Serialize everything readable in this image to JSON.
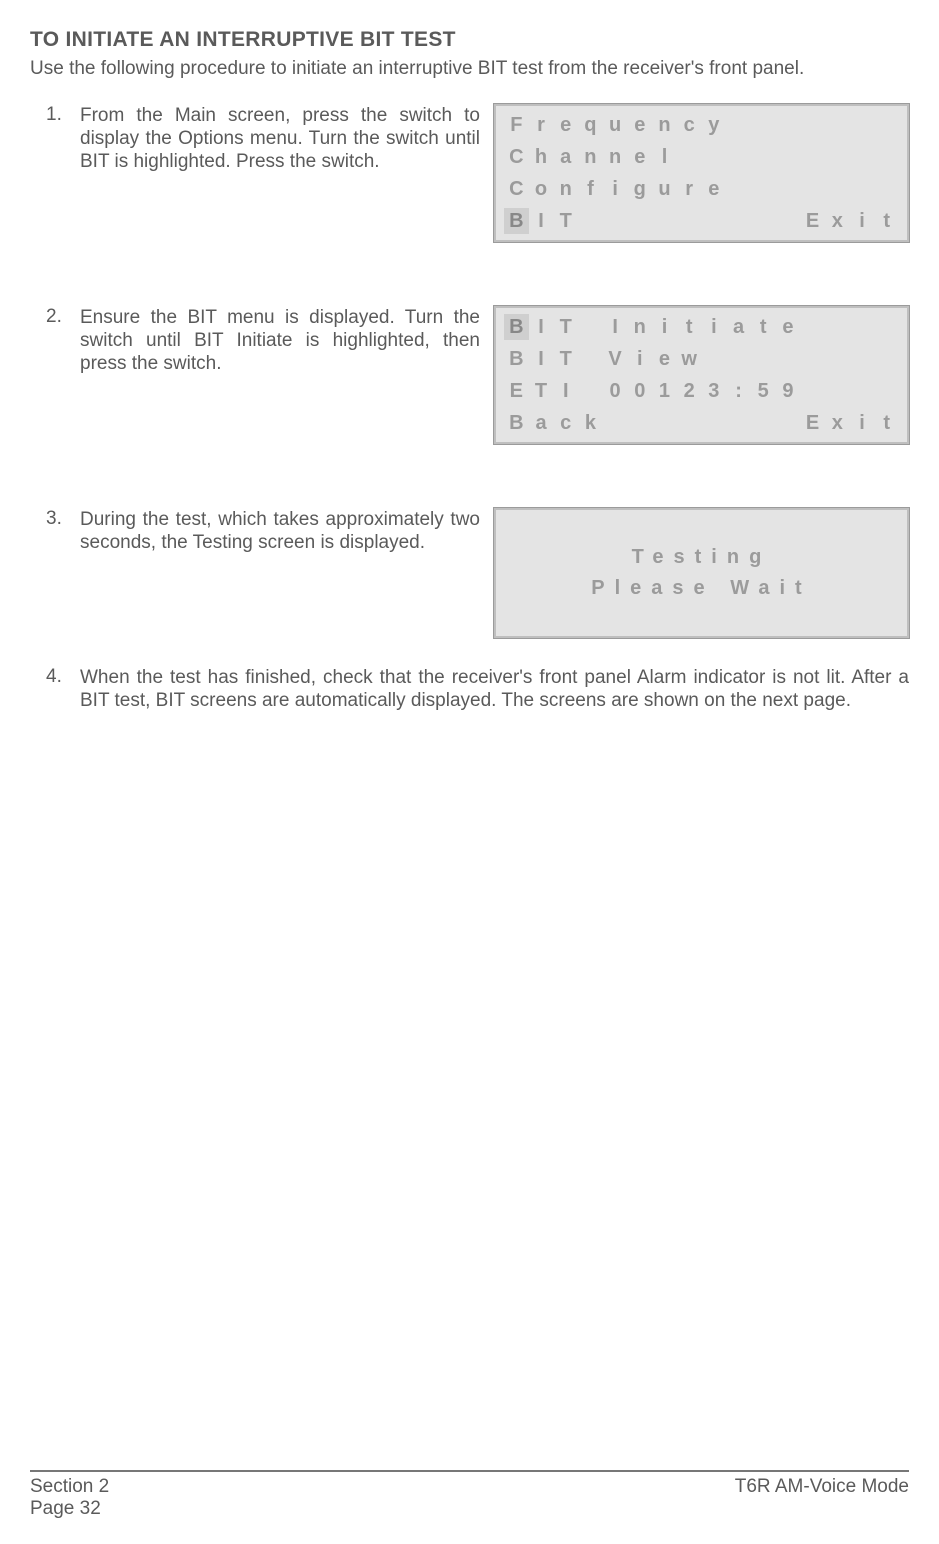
{
  "title": "TO INITIATE AN INTERRUPTIVE BIT TEST",
  "intro": "Use the following procedure to initiate an interruptive BIT test from the receiver's front panel.",
  "steps": {
    "s1": {
      "num": "1.",
      "text": "From the Main screen, press the switch to display the Options menu. Turn the switch until BIT is highlighted. Press the switch."
    },
    "s2": {
      "num": "2.",
      "text": "Ensure the BIT menu is displayed. Turn the switch until BIT Initiate is highlighted, then press the switch."
    },
    "s3": {
      "num": "3.",
      "text": "During the test, which takes approximately two seconds, the Testing screen is displayed."
    },
    "s4": {
      "num": "4.",
      "text": "When the test has finished, check that the receiver's front panel Alarm indicator is not lit. After a BIT test, BIT screens are automatically displayed. The screens are shown on the next page."
    }
  },
  "lcd1": {
    "rows": [
      [
        "F",
        "r",
        "e",
        "q",
        "u",
        "e",
        "n",
        "c",
        "y",
        "",
        "",
        "",
        "",
        "",
        "",
        ""
      ],
      [
        "C",
        "h",
        "a",
        "n",
        "n",
        "e",
        "l",
        "",
        "",
        "",
        "",
        "",
        "",
        "",
        "",
        ""
      ],
      [
        "C",
        "o",
        "n",
        "f",
        "i",
        "g",
        "u",
        "r",
        "e",
        "",
        "",
        "",
        "",
        "",
        "",
        ""
      ],
      [
        "B",
        "I",
        "T",
        "",
        "",
        "",
        "",
        "",
        "",
        "",
        "",
        "",
        "E",
        "x",
        "i",
        "t"
      ]
    ],
    "highlight": {
      "row": 3,
      "col": 0
    }
  },
  "lcd2": {
    "rows": [
      [
        "B",
        "I",
        "T",
        "",
        "I",
        "n",
        "i",
        "t",
        "i",
        "a",
        "t",
        "e",
        "",
        "",
        "",
        ""
      ],
      [
        "B",
        "I",
        "T",
        "",
        "V",
        "i",
        "e",
        "w",
        "",
        "",
        "",
        "",
        "",
        "",
        "",
        ""
      ],
      [
        "E",
        "T",
        "I",
        "",
        "0",
        "0",
        "1",
        "2",
        "3",
        ":",
        "5",
        "9",
        "",
        "",
        "",
        ""
      ],
      [
        "B",
        "a",
        "c",
        "k",
        "",
        "",
        "",
        "",
        "",
        "",
        "",
        "",
        "E",
        "x",
        "i",
        "t"
      ]
    ],
    "highlight": {
      "row": 0,
      "col": 0
    }
  },
  "lcd3": {
    "line1": "Testing",
    "line2": "Please Wait"
  },
  "footer": {
    "section": "Section 2",
    "page": "Page 32",
    "right": "T6R AM-Voice Mode"
  }
}
